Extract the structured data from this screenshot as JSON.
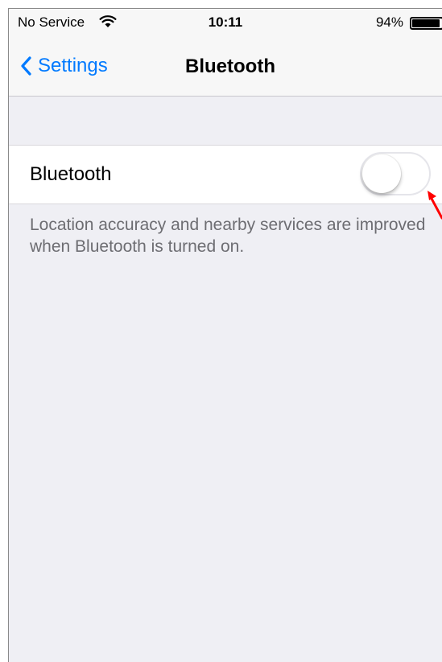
{
  "status_bar": {
    "carrier": "No Service",
    "wifi_icon": "wifi-icon",
    "time": "10:11",
    "battery_percent": "94%",
    "battery_level": 0.94
  },
  "nav": {
    "back_label": "Settings",
    "title": "Bluetooth"
  },
  "settings": {
    "bluetooth_label": "Bluetooth",
    "bluetooth_on": false,
    "footer_text": "Location accuracy and nearby services are improved when Bluetooth is turned on."
  },
  "colors": {
    "accent": "#007aff",
    "background": "#efeff4",
    "annotation_arrow": "#ff0000"
  }
}
